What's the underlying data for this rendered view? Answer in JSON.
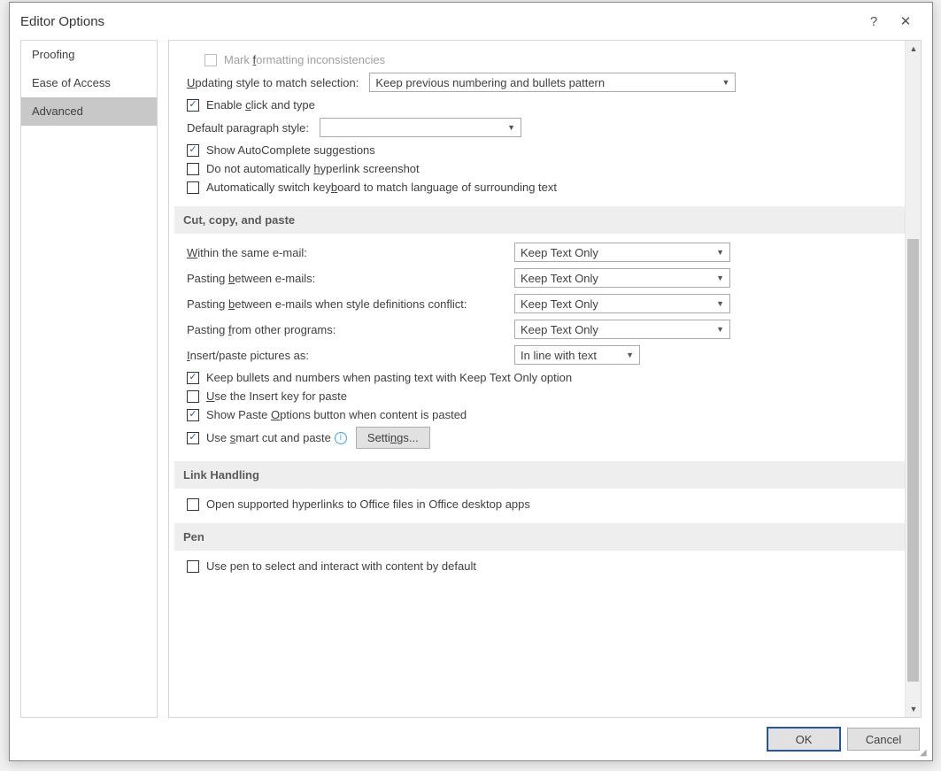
{
  "window": {
    "title": "Editor Options",
    "help": "?",
    "close": "✕"
  },
  "sidebar": {
    "items": [
      {
        "label": "Proofing"
      },
      {
        "label": "Ease of Access"
      },
      {
        "label": "Advanced"
      }
    ]
  },
  "top": {
    "mark_formatting": "Mark formatting inconsistencies",
    "updating_label": "Updating style to match selection:",
    "updating_value": "Keep previous numbering and bullets pattern",
    "enable_click": "Enable click and type",
    "default_para_label": "Default paragraph style:",
    "default_para_value": "",
    "autocomplete": "Show AutoComplete suggestions",
    "no_hyperlink": "Do not automatically hyperlink screenshot",
    "auto_kbd": "Automatically switch keyboard to match language of surrounding text"
  },
  "sections": {
    "ccp": "Cut, copy, and paste",
    "link": "Link Handling",
    "pen": "Pen"
  },
  "ccp": {
    "within_label": "Within the same e-mail:",
    "within_value": "Keep Text Only",
    "between_label": "Pasting between e-mails:",
    "between_value": "Keep Text Only",
    "conflict_label": "Pasting between e-mails when style definitions conflict:",
    "conflict_value": "Keep Text Only",
    "other_label": "Pasting from other programs:",
    "other_value": "Keep Text Only",
    "insert_pic_label": "Insert/paste pictures as:",
    "insert_pic_value": "In line with text",
    "keep_bullets": "Keep bullets and numbers when pasting text with Keep Text Only option",
    "insert_key": "Use the Insert key for paste",
    "paste_options": "Show Paste Options button when content is pasted",
    "smart_cut": "Use smart cut and paste",
    "settings_btn": "Settings..."
  },
  "link": {
    "open_office": "Open supported hyperlinks to Office files in Office desktop apps"
  },
  "pen": {
    "use_pen": "Use pen to select and interact with content by default"
  },
  "footer": {
    "ok": "OK",
    "cancel": "Cancel"
  }
}
